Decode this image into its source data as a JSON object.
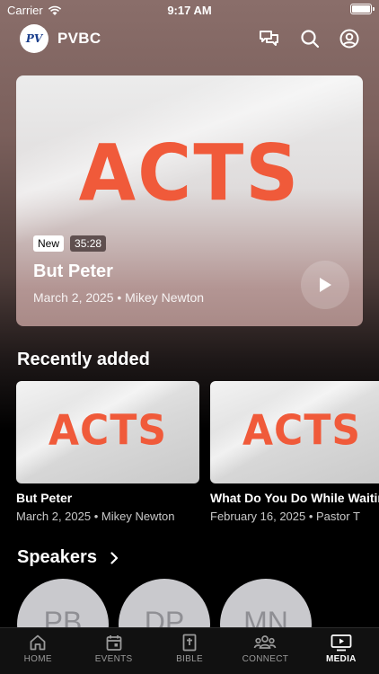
{
  "status_bar": {
    "carrier": "Carrier",
    "time": "9:17 AM"
  },
  "header": {
    "logo_text": "PV",
    "brand": "PVBC"
  },
  "hero": {
    "artwork_text": "ACTS",
    "badge_new": "New",
    "duration": "35:28",
    "title": "But Peter",
    "meta": "March 2, 2025 • Mikey Newton"
  },
  "recent": {
    "title": "Recently added",
    "items": [
      {
        "artwork_text": "ACTS",
        "title": "But Peter",
        "meta": "March 2, 2025 • Mikey Newton"
      },
      {
        "artwork_text": "ACTS",
        "title": "What Do You Do While Waiting",
        "meta": "February 16, 2025 • Pastor T"
      }
    ]
  },
  "speakers": {
    "title": "Speakers",
    "items": [
      {
        "initials": "PB"
      },
      {
        "initials": "DP"
      },
      {
        "initials": "MN"
      }
    ]
  },
  "tabs": [
    {
      "label": "HOME",
      "icon": "home-icon"
    },
    {
      "label": "EVENTS",
      "icon": "calendar-icon"
    },
    {
      "label": "BIBLE",
      "icon": "bible-icon"
    },
    {
      "label": "CONNECT",
      "icon": "people-icon"
    },
    {
      "label": "MEDIA",
      "icon": "media-icon",
      "active": true
    }
  ],
  "colors": {
    "accent": "#f05a3a",
    "tab_inactive": "#9a9a9a",
    "tab_active": "#ffffff"
  }
}
